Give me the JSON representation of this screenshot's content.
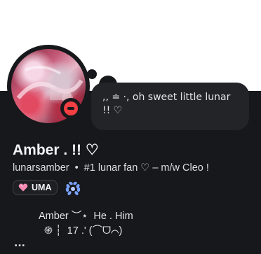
{
  "profile": {
    "display_name": "Amber . !! ♡",
    "username": "lunarsamber",
    "separator": "•",
    "pronoun_tagline": "#1 lunar fan ♡ – m/w Cleo !",
    "status": "do-not-disturb",
    "status_color": "#f23f43",
    "custom_status": ",, ≐ ·, oh sweet little lunar !! ♡",
    "badges": [
      {
        "label": "UMA",
        "icon": "pink-heart-icon",
        "color": "#f58bb5"
      },
      {
        "label": "",
        "icon": "laurel-wreath-icon",
        "color": "#7aa2ff"
      }
    ],
    "bio_line1": "Amber ︶⋆  He . Him",
    "bio_line2": "֍ ┆  17 .' (⌒ᗜ⌒)",
    "more_indicator": "..."
  },
  "colors": {
    "panel": "#17181b",
    "bubble": "#232428",
    "accent": "#f23f43"
  }
}
